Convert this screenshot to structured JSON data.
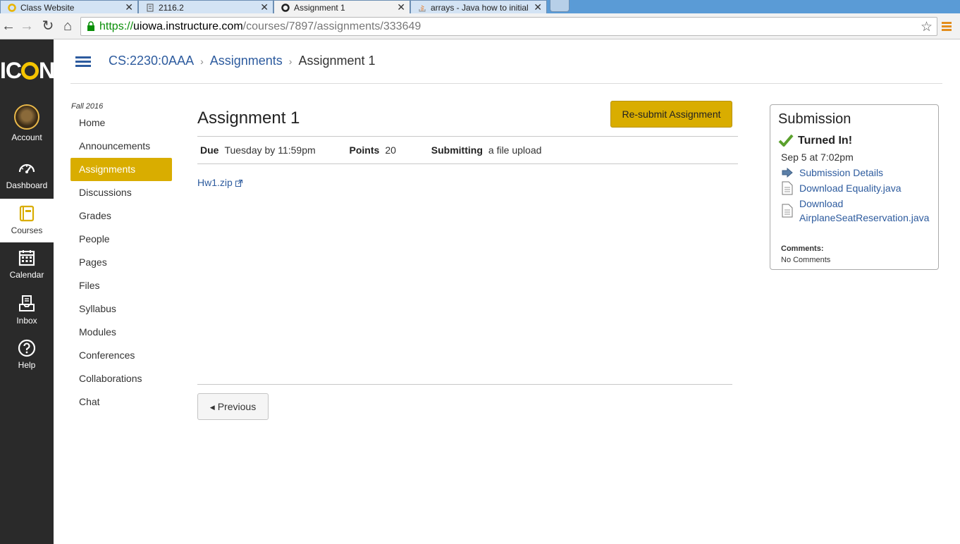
{
  "browser": {
    "tabs": [
      {
        "label": "Class Website"
      },
      {
        "label": "2116.2"
      },
      {
        "label": "Assignment 1"
      },
      {
        "label": "arrays - Java how to initial"
      }
    ],
    "url_https": "https://",
    "url_host": "uiowa.instructure.com",
    "url_path": "/courses/7897/assignments/333649"
  },
  "global_nav": {
    "logo": "ICON",
    "items": [
      {
        "label": "Account",
        "icon": "avatar"
      },
      {
        "label": "Dashboard",
        "icon": "dashboard-icon"
      },
      {
        "label": "Courses",
        "icon": "courses-icon"
      },
      {
        "label": "Calendar",
        "icon": "calendar-icon"
      },
      {
        "label": "Inbox",
        "icon": "inbox-icon"
      },
      {
        "label": "Help",
        "icon": "help-icon"
      }
    ]
  },
  "breadcrumb": {
    "course": "CS:2230:0AAA",
    "section": "Assignments",
    "current": "Assignment 1"
  },
  "course_nav": {
    "term": "Fall 2016",
    "items": [
      "Home",
      "Announcements",
      "Assignments",
      "Discussions",
      "Grades",
      "People",
      "Pages",
      "Files",
      "Syllabus",
      "Modules",
      "Conferences",
      "Collaborations",
      "Chat"
    ],
    "active": "Assignments"
  },
  "assignment": {
    "title": "Assignment 1",
    "resubmit_label": "Re-submit Assignment",
    "due_label": "Due",
    "due_value": "Tuesday by 11:59pm",
    "points_label": "Points",
    "points_value": "20",
    "submitting_label": "Submitting",
    "submitting_value": "a file upload",
    "attachment": "Hw1.zip",
    "previous_label": "Previous"
  },
  "submission": {
    "title": "Submission",
    "status": "Turned In!",
    "date": "Sep 5 at 7:02pm",
    "details_link": "Submission Details",
    "download1": "Download Equality.java",
    "download2_line1": "Download",
    "download2_line2": "AirplaneSeatReservation.java",
    "comments_label": "Comments:",
    "comments_value": "No Comments"
  },
  "colors": {
    "accent": "#d9ad00",
    "link": "#2d5b9e",
    "nav_bg": "#2a2a2a"
  }
}
